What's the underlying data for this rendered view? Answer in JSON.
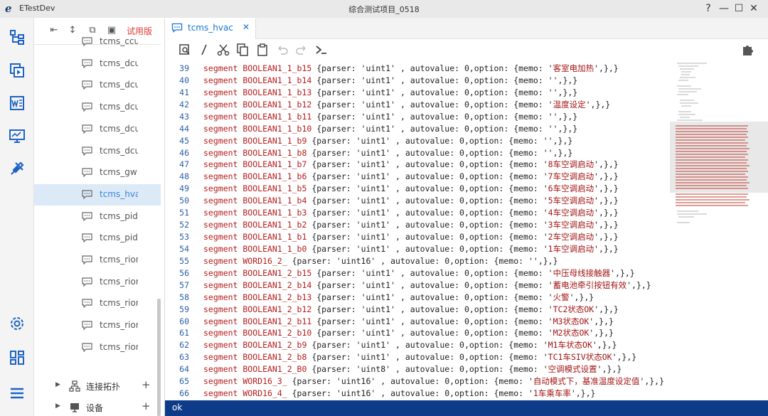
{
  "window": {
    "app_name": "ETestDev",
    "title": "综合测试项目_0518",
    "controls": [
      "?",
      "—",
      "☐",
      "✕"
    ]
  },
  "rail": {
    "icons": [
      "structure-icon",
      "copy-play-icon",
      "word-doc-icon",
      "monitor-icon",
      "tools-icon",
      "settings-icon",
      "dashboard-icon",
      "menu-icon"
    ]
  },
  "tree": {
    "toolbar": {
      "trial_label": "试用版"
    },
    "items": [
      {
        "label": "tcms_ccu"
      },
      {
        "label": "tcms_dcu"
      },
      {
        "label": "tcms_dcu"
      },
      {
        "label": "tcms_dcu"
      },
      {
        "label": "tcms_dcu"
      },
      {
        "label": "tcms_dcu"
      },
      {
        "label": "tcms_gw"
      },
      {
        "label": "tcms_hva",
        "selected": true
      },
      {
        "label": "tcms_pids"
      },
      {
        "label": "tcms_pids"
      },
      {
        "label": "tcms_rion"
      },
      {
        "label": "tcms_rion"
      },
      {
        "label": "tcms_rion"
      },
      {
        "label": "tcms_rion"
      },
      {
        "label": "tcms_rion"
      }
    ],
    "groups": [
      {
        "label": "连接拓扑",
        "icon": "topology-icon"
      },
      {
        "label": "设备",
        "icon": "device-icon"
      }
    ]
  },
  "editor": {
    "tab": {
      "label": "tcms_hvac",
      "close": "✕"
    },
    "status": "ok",
    "lines": [
      {
        "n": "39",
        "name": "BOOLEAN1_1_b15",
        "parser": "uint1",
        "memo": "客室电加热"
      },
      {
        "n": "40",
        "name": "BOOLEAN1_1_b14",
        "parser": "uint1",
        "memo": ""
      },
      {
        "n": "41",
        "name": "BOOLEAN1_1_b13",
        "parser": "uint1",
        "memo": ""
      },
      {
        "n": "42",
        "name": "BOOLEAN1_1_b12",
        "parser": "uint1",
        "memo": "温度设定"
      },
      {
        "n": "43",
        "name": "BOOLEAN1_1_b11",
        "parser": "uint1",
        "memo": ""
      },
      {
        "n": "44",
        "name": "BOOLEAN1_1_b10",
        "parser": "uint1",
        "memo": ""
      },
      {
        "n": "45",
        "name": "BOOLEAN1_1_b9",
        "parser": "uint1",
        "memo": ""
      },
      {
        "n": "46",
        "name": "BOOLEAN1_1_b8",
        "parser": "uint1",
        "memo": ""
      },
      {
        "n": "47",
        "name": "BOOLEAN1_1_b7",
        "parser": "uint1",
        "memo": "8车空调启动"
      },
      {
        "n": "48",
        "name": "BOOLEAN1_1_b6",
        "parser": "uint1",
        "memo": "7车空调启动"
      },
      {
        "n": "49",
        "name": "BOOLEAN1_1_b5",
        "parser": "uint1",
        "memo": "6车空调启动"
      },
      {
        "n": "50",
        "name": "BOOLEAN1_1_b4",
        "parser": "uint1",
        "memo": "5车空调启动"
      },
      {
        "n": "51",
        "name": "BOOLEAN1_1_b3",
        "parser": "uint1",
        "memo": "4车空调启动"
      },
      {
        "n": "52",
        "name": "BOOLEAN1_1_b2",
        "parser": "uint1",
        "memo": "3车空调启动"
      },
      {
        "n": "53",
        "name": "BOOLEAN1_1_b1",
        "parser": "uint1",
        "memo": "2车空调启动"
      },
      {
        "n": "54",
        "name": "BOOLEAN1_1_b0",
        "parser": "uint1",
        "memo": "1车空调启动"
      },
      {
        "n": "55",
        "name": "WORD16_2_",
        "parser": "uint16",
        "memo": ""
      },
      {
        "n": "56",
        "name": "BOOLEAN1_2_b15",
        "parser": "uint1",
        "memo": "中压母线接触器"
      },
      {
        "n": "57",
        "name": "BOOLEAN1_2_b14",
        "parser": "uint1",
        "memo": "蓄电池牵引按钮有效"
      },
      {
        "n": "58",
        "name": "BOOLEAN1_2_b13",
        "parser": "uint1",
        "memo": "火警"
      },
      {
        "n": "59",
        "name": "BOOLEAN1_2_b12",
        "parser": "uint1",
        "memo": "TC2状态OK"
      },
      {
        "n": "60",
        "name": "BOOLEAN1_2_b11",
        "parser": "uint1",
        "memo": "M3状态OK"
      },
      {
        "n": "61",
        "name": "BOOLEAN1_2_b10",
        "parser": "uint1",
        "memo": "M2状态OK"
      },
      {
        "n": "62",
        "name": "BOOLEAN1_2_b9",
        "parser": "uint1",
        "memo": "M1车状态OK"
      },
      {
        "n": "63",
        "name": "BOOLEAN1_2_b8",
        "parser": "uint1",
        "memo": "TC1车SIV状态OK"
      },
      {
        "n": "64",
        "name": "BOOLEAN1_2_B0",
        "parser": "uint8",
        "memo": "空调模式设置"
      },
      {
        "n": "65",
        "name": "WORD16_3_",
        "parser": "uint16",
        "memo": "自动模式下，基准温度设定值"
      },
      {
        "n": "66",
        "name": "WORD16_4_",
        "parser": "uint16",
        "memo": "1车乘车率"
      }
    ]
  }
}
